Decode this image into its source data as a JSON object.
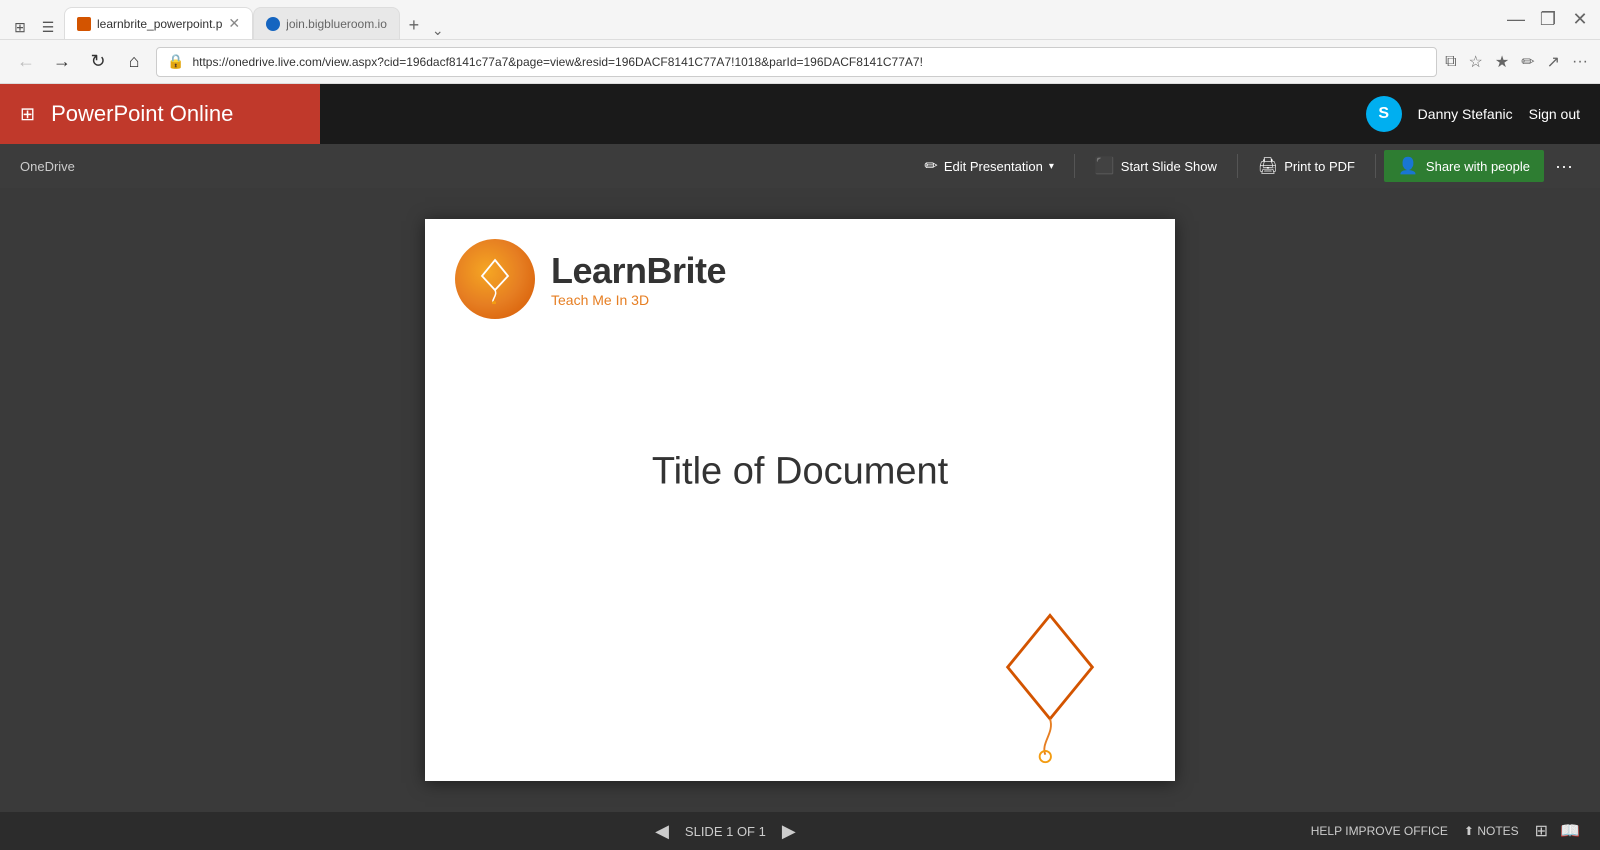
{
  "browser": {
    "tabs": [
      {
        "id": "tab1",
        "title": "learnbrite_powerpoint.p",
        "active": true,
        "favicon": "doc"
      },
      {
        "id": "tab2",
        "title": "join.bigblueroom.io",
        "active": false,
        "favicon": "globe"
      }
    ],
    "address": "https://onedrive.live.com/view.aspx?cid=196dacf8141c77a7&page=view&resid=196DACF8141C77A7!1018&parId=196DACF8141C77A7!",
    "new_tab_label": "+",
    "window_controls": {
      "minimize": "—",
      "maximize": "❐",
      "close": "✕"
    }
  },
  "app": {
    "title": "PowerPoint Online",
    "user_name": "Danny Stefanic",
    "sign_out": "Sign out",
    "skype_initial": "S"
  },
  "secondary_toolbar": {
    "onedrive": "OneDrive",
    "edit_label": "Edit Presentation",
    "slideshow_label": "Start Slide Show",
    "print_label": "Print to PDF",
    "share_label": "Share with people",
    "more_label": "···"
  },
  "slide": {
    "logo_name": "LearnBrite",
    "logo_tagline": "Teach Me In 3D",
    "title": "Title of Document"
  },
  "status_bar": {
    "prev_arrow": "◀",
    "slide_info": "SLIDE 1 OF 1",
    "next_arrow": "▶",
    "help": "HELP IMPROVE OFFICE",
    "notes": "NOTES"
  }
}
